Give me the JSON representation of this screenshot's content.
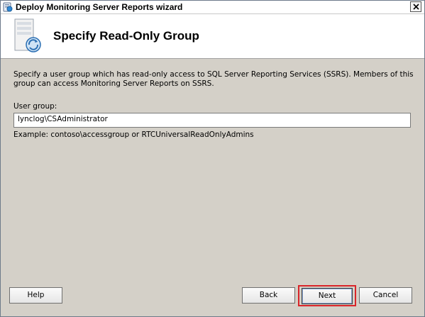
{
  "window": {
    "title": "Deploy Monitoring Server Reports wizard"
  },
  "header": {
    "title": "Specify Read-Only Group"
  },
  "main": {
    "description": "Specify a user group which has read-only access to SQL Server Reporting Services (SSRS). Members of this group can access Monitoring Server Reports on SSRS.",
    "user_group_label": "User group:",
    "user_group_value": "lynclog\\CSAdministrator",
    "example": "Example: contoso\\accessgroup or RTCUniversalReadOnlyAdmins"
  },
  "buttons": {
    "help": "Help",
    "back": "Back",
    "next": "Next",
    "cancel": "Cancel"
  },
  "icons": {
    "app": "wizard-app-icon",
    "header": "server-reports-icon",
    "close": "close-icon"
  },
  "colors": {
    "dialog_bg": "#d4d0c8",
    "header_bg": "#ffffff",
    "highlight": "#d9252a"
  }
}
